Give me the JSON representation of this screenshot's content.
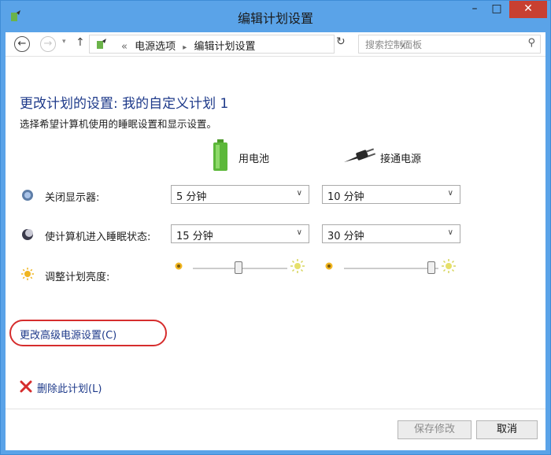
{
  "window": {
    "title": "编辑计划设置",
    "minimize": "–",
    "maximize": "□",
    "close": "✕"
  },
  "address": {
    "crumb_prefix": "«",
    "crumb1": "电源选项",
    "separator": "▸",
    "crumb2": "编辑计划设置",
    "search_placeholder": "搜索控制面板"
  },
  "main": {
    "heading": "更改计划的设置: 我的自定义计划 1",
    "description": "选择希望计算机使用的睡眠设置和显示设置。",
    "col_battery": "用电池",
    "col_plugged": "接通电源",
    "rows": [
      {
        "label": "关闭显示器:",
        "battery": "5 分钟",
        "plugged": "10 分钟"
      },
      {
        "label": "使计算机进入睡眠状态:",
        "battery": "15 分钟",
        "plugged": "30 分钟"
      },
      {
        "label": "调整计划亮度:"
      }
    ],
    "brightness": {
      "battery_level": 0.48,
      "plugged_level": 0.96
    },
    "advanced_link": "更改高级电源设置(C)",
    "delete_link": "删除此计划(L)"
  },
  "footer": {
    "save": "保存修改",
    "cancel": "取消"
  },
  "colors": {
    "titlebar": "#5aa3e8",
    "close": "#c84031",
    "link": "#1e3a8a",
    "highlight": "#d62d2d"
  }
}
